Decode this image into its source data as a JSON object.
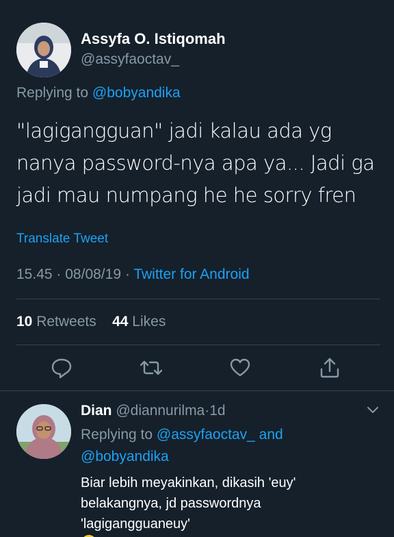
{
  "tweet": {
    "author_name": "Assyfa O. Istiqomah",
    "author_handle": "@assyfaoctav_",
    "replying_prefix": "Replying to",
    "replying_to": "@bobyandika",
    "text_lines": [
      "\"lagigangguan\" jadi kalau ada yg",
      "nanya password-nya apa ya... Jadi ga",
      "jadi mau numpang he he sorry fren"
    ],
    "translate_label": "Translate Tweet",
    "time": "15.45",
    "date": "08/08/19",
    "separator": "·",
    "source": "Twitter for Android",
    "retweets_count": "10",
    "retweets_label": "Retweets",
    "likes_count": "44",
    "likes_label": "Likes"
  },
  "reply": {
    "name": "Dian",
    "handle": "@diannurilma",
    "separator": "·",
    "age": "1d",
    "replying_prefix": "Replying to",
    "replying_to_1": "@assyfaoctav_",
    "conjunction": "and",
    "replying_to_2": "@bobyandika",
    "text_lines": [
      "Biar lebih meyakinkan, dikasih 'euy'",
      "belakangnya, jd passwordnya",
      "'lagigangguaneuy'"
    ],
    "emoji": "face-with-tears-of-joy"
  },
  "icons": {
    "reply": "reply-icon",
    "retweet": "retweet-icon",
    "like": "heart-icon",
    "share": "share-icon",
    "more": "chevron-down-icon"
  },
  "colors": {
    "background": "#15202b",
    "accent": "#1da1f2",
    "muted": "#8899a6",
    "divider": "#38444d"
  }
}
